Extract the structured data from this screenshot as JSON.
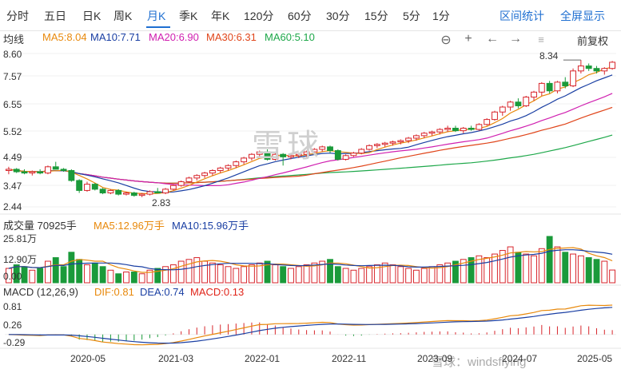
{
  "tabs": [
    "分时",
    "五日",
    "日K",
    "周K",
    "月K",
    "季K",
    "年K",
    "120分",
    "60分",
    "30分",
    "15分",
    "5分",
    "1分"
  ],
  "active_tab": "月K",
  "links": {
    "interval_stats": "区间统计",
    "fullscreen": "全屏显示"
  },
  "legend_main": [
    {
      "label": "均线",
      "color": "#333333"
    },
    {
      "label": "MA5:8.04",
      "color": "#e8890c"
    },
    {
      "label": "MA10:7.71",
      "color": "#1a3fa3"
    },
    {
      "label": "MA20:6.90",
      "color": "#d020b0"
    },
    {
      "label": "MA30:6.31",
      "color": "#e0451a"
    },
    {
      "label": "MA60:5.10",
      "color": "#1ea84a"
    }
  ],
  "controls": {
    "minus": "⊖",
    "plus": "+",
    "left": "←",
    "right": "→",
    "adjust": "前复权"
  },
  "price_axis": [
    "8.60",
    "7.57",
    "6.55",
    "5.52",
    "4.49",
    "3.47",
    "2.44"
  ],
  "price_high_label": "8.34",
  "price_low_label": "2.83",
  "volume_legend": [
    {
      "label": "成交量 70925手",
      "color": "#333333"
    },
    {
      "label": "MA5:12.96万手",
      "color": "#e8890c"
    },
    {
      "label": "MA10:15.96万手",
      "color": "#1a3fa3"
    }
  ],
  "volume_axis": [
    "25.81万",
    "12.90万",
    "0.00"
  ],
  "macd_legend": [
    {
      "label": "MACD (12,26,9)",
      "color": "#333333"
    },
    {
      "label": "DIF:0.81",
      "color": "#e8890c"
    },
    {
      "label": "DEA:0.74",
      "color": "#1a3fa3"
    },
    {
      "label": "MACD:0.13",
      "color": "#e0251a"
    }
  ],
  "macd_axis": [
    "0.81",
    "0.26",
    "-0.29"
  ],
  "x_axis": [
    "2020-05",
    "2021-03",
    "2022-01",
    "2022-11",
    "2023-09",
    "2024-07",
    "2025-05"
  ],
  "watermark_center": "雪球",
  "watermark_corner": "雪球：windsflying",
  "colors": {
    "up": "#d8262c",
    "down": "#1a9a3a",
    "accent": "#1f6fd1"
  },
  "chart_data": {
    "type": "candlestick",
    "ohlc": [
      [
        3.9,
        4.05,
        3.75,
        3.95
      ],
      [
        3.95,
        4.0,
        3.8,
        3.85
      ],
      [
        3.85,
        3.95,
        3.75,
        3.8
      ],
      [
        3.8,
        3.9,
        3.7,
        3.85
      ],
      [
        3.85,
        3.95,
        3.75,
        3.8
      ],
      [
        3.8,
        4.1,
        3.75,
        4.05
      ],
      [
        4.05,
        4.25,
        3.95,
        3.95
      ],
      [
        3.95,
        4.0,
        3.85,
        3.9
      ],
      [
        3.9,
        3.95,
        3.45,
        3.5
      ],
      [
        3.5,
        3.55,
        3.0,
        3.1
      ],
      [
        3.1,
        3.45,
        3.05,
        3.35
      ],
      [
        3.35,
        3.4,
        3.1,
        3.15
      ],
      [
        3.15,
        3.2,
        2.95,
        3.0
      ],
      [
        3.0,
        3.15,
        2.95,
        3.1
      ],
      [
        3.1,
        3.15,
        2.9,
        2.95
      ],
      [
        2.95,
        3.05,
        2.9,
        3.0
      ],
      [
        3.0,
        3.05,
        2.85,
        2.9
      ],
      [
        2.9,
        3.0,
        2.83,
        2.95
      ],
      [
        2.95,
        3.1,
        2.9,
        3.05
      ],
      [
        3.05,
        3.2,
        3.0,
        3.0
      ],
      [
        3.0,
        3.2,
        2.95,
        3.15
      ],
      [
        3.15,
        3.35,
        3.1,
        3.3
      ],
      [
        3.3,
        3.5,
        3.25,
        3.45
      ],
      [
        3.45,
        3.65,
        3.4,
        3.6
      ],
      [
        3.6,
        3.75,
        3.5,
        3.7
      ],
      [
        3.7,
        3.85,
        3.6,
        3.8
      ],
      [
        3.8,
        3.95,
        3.7,
        3.9
      ],
      [
        3.9,
        4.05,
        3.8,
        4.0
      ],
      [
        4.0,
        4.15,
        3.9,
        4.1
      ],
      [
        4.1,
        4.3,
        4.0,
        4.25
      ],
      [
        4.25,
        4.45,
        4.15,
        4.4
      ],
      [
        4.4,
        4.6,
        4.3,
        4.55
      ],
      [
        4.55,
        4.7,
        4.45,
        4.65
      ],
      [
        4.65,
        4.75,
        4.3,
        4.35
      ],
      [
        4.35,
        4.6,
        4.3,
        4.55
      ],
      [
        4.55,
        4.6,
        4.1,
        4.45
      ],
      [
        4.45,
        4.55,
        4.35,
        4.5
      ],
      [
        4.5,
        4.6,
        4.4,
        4.55
      ],
      [
        4.55,
        4.7,
        4.45,
        4.65
      ],
      [
        4.65,
        4.8,
        4.55,
        4.75
      ],
      [
        4.75,
        4.9,
        4.65,
        4.85
      ],
      [
        4.85,
        4.9,
        4.6,
        4.7
      ],
      [
        4.7,
        4.75,
        4.3,
        4.35
      ],
      [
        4.35,
        4.55,
        4.3,
        4.5
      ],
      [
        4.5,
        4.65,
        4.45,
        4.6
      ],
      [
        4.6,
        4.8,
        4.55,
        4.75
      ],
      [
        4.75,
        4.95,
        4.7,
        4.9
      ],
      [
        4.9,
        5.0,
        4.8,
        4.95
      ],
      [
        4.95,
        5.05,
        4.85,
        5.0
      ],
      [
        5.0,
        5.1,
        4.9,
        5.05
      ],
      [
        5.05,
        5.15,
        4.95,
        5.1
      ],
      [
        5.1,
        5.25,
        5.0,
        5.2
      ],
      [
        5.2,
        5.35,
        5.1,
        5.3
      ],
      [
        5.3,
        5.45,
        5.2,
        5.4
      ],
      [
        5.4,
        5.5,
        5.3,
        5.45
      ],
      [
        5.45,
        5.6,
        5.35,
        5.55
      ],
      [
        5.55,
        5.7,
        5.45,
        5.6
      ],
      [
        5.6,
        5.7,
        5.45,
        5.5
      ],
      [
        5.5,
        5.65,
        5.4,
        5.6
      ],
      [
        5.6,
        5.7,
        5.5,
        5.55
      ],
      [
        5.55,
        5.8,
        5.5,
        5.75
      ],
      [
        5.75,
        6.0,
        5.7,
        5.95
      ],
      [
        5.95,
        6.3,
        5.9,
        6.25
      ],
      [
        6.25,
        6.5,
        6.1,
        6.45
      ],
      [
        6.45,
        6.7,
        6.3,
        6.65
      ],
      [
        6.65,
        6.8,
        6.4,
        6.5
      ],
      [
        6.5,
        6.9,
        6.45,
        6.85
      ],
      [
        6.85,
        7.1,
        6.7,
        7.05
      ],
      [
        7.05,
        7.45,
        6.9,
        7.4
      ],
      [
        7.4,
        7.5,
        7.0,
        7.1
      ],
      [
        7.1,
        7.5,
        7.0,
        7.45
      ],
      [
        7.45,
        7.65,
        7.2,
        7.3
      ],
      [
        7.3,
        8.0,
        7.25,
        7.9
      ],
      [
        7.9,
        8.34,
        7.8,
        8.1
      ],
      [
        8.1,
        8.2,
        7.9,
        8.0
      ],
      [
        8.0,
        8.1,
        7.8,
        7.9
      ],
      [
        7.9,
        8.05,
        7.75,
        8.0
      ],
      [
        8.0,
        8.3,
        7.95,
        8.25
      ]
    ],
    "volume_wan": [
      8,
      10,
      9,
      7,
      8,
      12,
      14,
      9,
      17,
      13,
      10,
      11,
      9,
      7,
      5,
      6,
      6,
      5,
      7,
      8,
      9,
      10,
      12,
      13,
      14,
      12,
      11,
      10,
      9,
      8,
      9,
      10,
      11,
      12,
      10,
      9,
      8,
      9,
      10,
      11,
      12,
      13,
      9,
      8,
      7,
      8,
      9,
      10,
      11,
      10,
      9,
      8,
      7,
      8,
      9,
      10,
      11,
      12,
      13,
      14,
      15,
      14,
      16,
      18,
      20,
      17,
      16,
      15,
      19,
      25.81,
      20,
      17,
      16,
      15,
      14,
      13,
      12,
      7.09
    ],
    "macd": {
      "dif": 0.81,
      "dea": 0.74,
      "macd": 0.13
    },
    "ma": {
      "ma5": 8.04,
      "ma10": 7.71,
      "ma20": 6.9,
      "ma30": 6.31,
      "ma60": 5.1
    },
    "ylim": [
      2.44,
      8.6
    ],
    "volume_ylim": [
      0,
      25.81
    ],
    "macd_ylim": [
      -0.29,
      0.81
    ]
  }
}
